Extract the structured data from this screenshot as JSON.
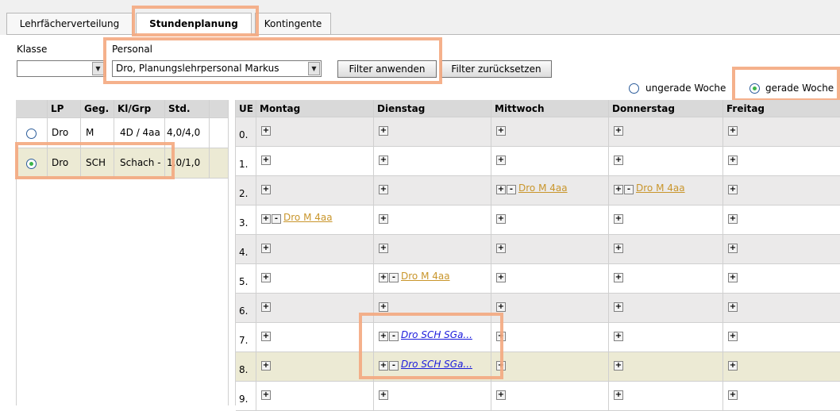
{
  "tabs": [
    {
      "label": "Lehrfächerverteilung"
    },
    {
      "label": "Stundenplanung"
    },
    {
      "label": "Kontingente"
    }
  ],
  "filter": {
    "klasse_label": "Klasse",
    "klasse_value": "",
    "personal_label": "Personal",
    "personal_value": "Dro, Planungslehrpersonal Markus",
    "apply_label": "Filter anwenden",
    "reset_label": "Filter zurücksetzen"
  },
  "week": {
    "odd_label": "ungerade Woche",
    "even_label": "gerade Woche",
    "selected": "gerade Woche"
  },
  "left_table": {
    "headers": [
      "LP",
      "Geg.",
      "Kl/Grp",
      "Std."
    ],
    "rows": [
      {
        "lp": "Dro",
        "geg": "M",
        "klgrp": "4D / 4aa",
        "std": "4,0/4,0",
        "selected": false
      },
      {
        "lp": "Dro",
        "geg": "SCH",
        "klgrp": "Schach -",
        "std": "1,0/1,0",
        "selected": true
      }
    ]
  },
  "schedule": {
    "headers": [
      "UE",
      "Montag",
      "Dienstag",
      "Mittwoch",
      "Donnerstag",
      "Freitag"
    ],
    "rows": [
      {
        "ue": "0.",
        "cells": [
          "",
          "",
          "",
          "",
          ""
        ]
      },
      {
        "ue": "1.",
        "cells": [
          "",
          "",
          "",
          "",
          ""
        ]
      },
      {
        "ue": "2.",
        "cells": [
          "",
          "",
          "Dro M 4aa",
          "Dro M 4aa",
          ""
        ]
      },
      {
        "ue": "3.",
        "cells": [
          "Dro M 4aa",
          "",
          "",
          "",
          ""
        ]
      },
      {
        "ue": "4.",
        "cells": [
          "",
          "",
          "",
          "",
          ""
        ]
      },
      {
        "ue": "5.",
        "cells": [
          "",
          "Dro M 4aa",
          "",
          "",
          ""
        ]
      },
      {
        "ue": "6.",
        "cells": [
          "",
          "",
          "",
          "",
          ""
        ]
      },
      {
        "ue": "7.",
        "cells": [
          "",
          "Dro SCH SGa...",
          "",
          "",
          ""
        ]
      },
      {
        "ue": "8.",
        "cells": [
          "",
          "Dro SCH SGa...",
          "",
          "",
          ""
        ]
      },
      {
        "ue": "9.",
        "cells": [
          "",
          "",
          "",
          "",
          ""
        ]
      }
    ]
  },
  "symbols": {
    "plus": "+",
    "minus": "-",
    "dropdown": "▼"
  },
  "colors": {
    "highlight": "#f4a97f",
    "link_gold": "#c9962c",
    "link_blue": "#1a1adc",
    "row_alt": "#ebeaea",
    "row_selected": "#ecead4"
  }
}
